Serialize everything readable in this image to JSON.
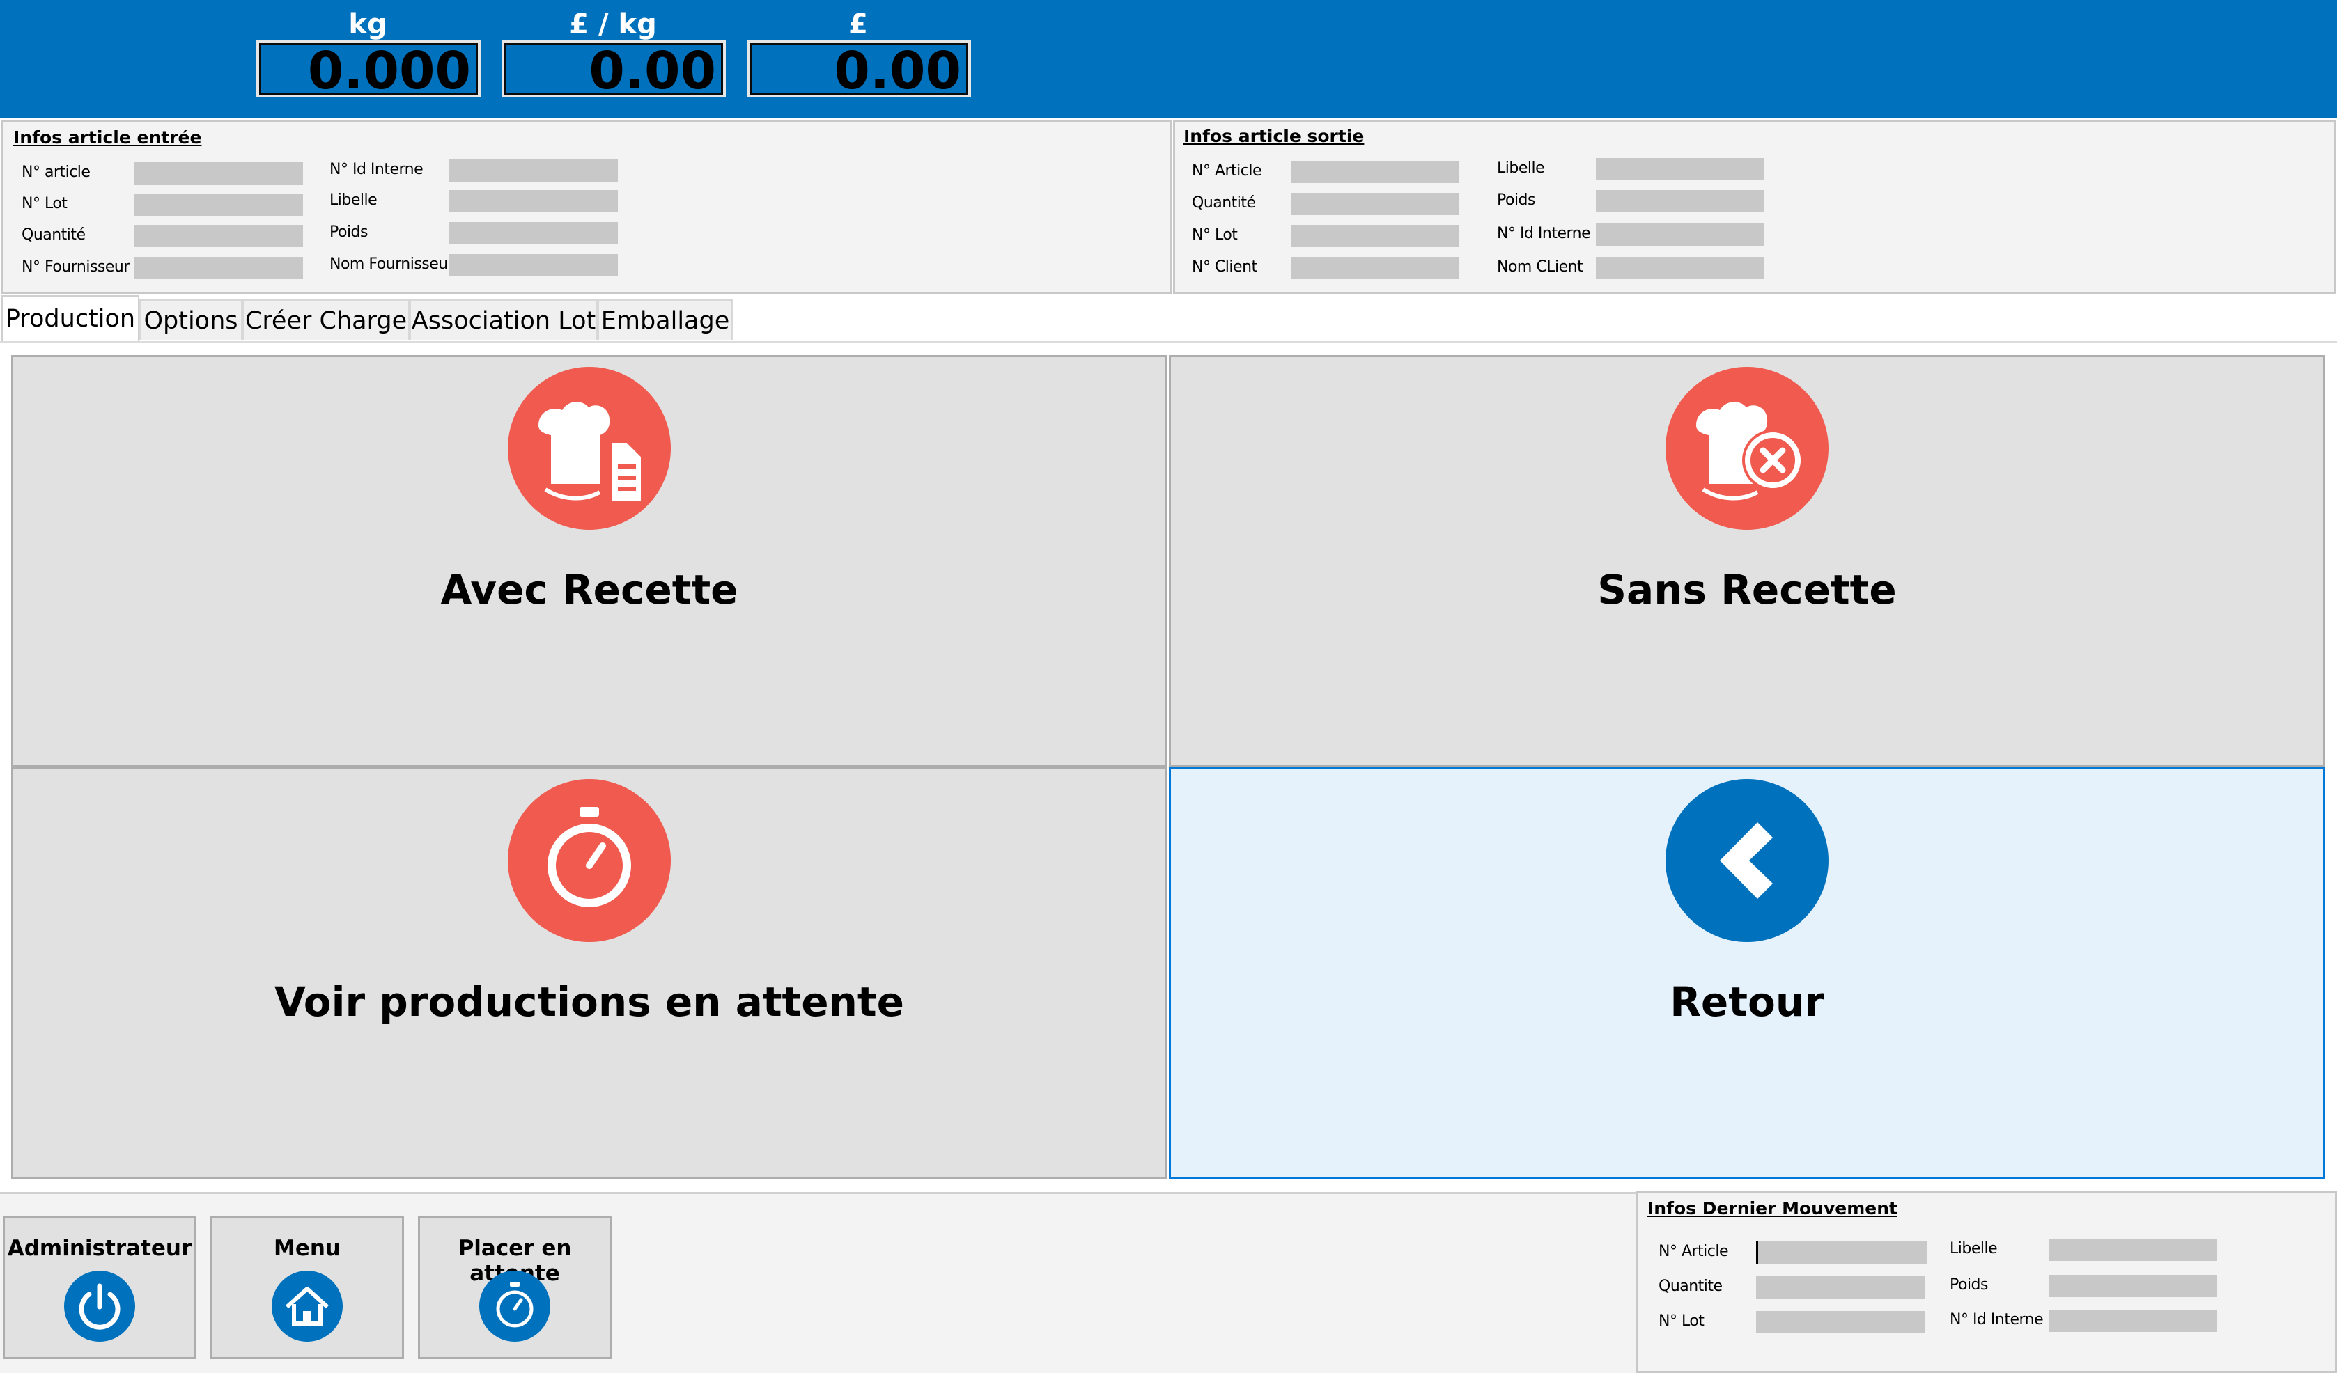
{
  "meters": [
    {
      "unit": "kg",
      "value": "0.000"
    },
    {
      "unit": "£ / kg",
      "value": "0.00"
    },
    {
      "unit": "£",
      "value": "0.00"
    }
  ],
  "input_panel": {
    "title": "Infos article entrée",
    "left_fields": [
      {
        "label": "N° article",
        "value": ""
      },
      {
        "label": "N° Lot",
        "value": ""
      },
      {
        "label": "Quantité",
        "value": ""
      },
      {
        "label": "N° Fournisseur",
        "value": ""
      }
    ],
    "right_fields": [
      {
        "label": "N° Id Interne",
        "value": ""
      },
      {
        "label": "Libelle",
        "value": ""
      },
      {
        "label": "Poids",
        "value": ""
      },
      {
        "label": "Nom Fournisseur",
        "value": ""
      }
    ]
  },
  "output_panel": {
    "title": "Infos article sortie",
    "left_fields": [
      {
        "label": "N° Article",
        "value": ""
      },
      {
        "label": "Quantité",
        "value": ""
      },
      {
        "label": "N° Lot",
        "value": ""
      },
      {
        "label": "N° Client",
        "value": ""
      }
    ],
    "right_fields": [
      {
        "label": "Libelle",
        "value": ""
      },
      {
        "label": "Poids",
        "value": ""
      },
      {
        "label": "N° Id Interne",
        "value": ""
      },
      {
        "label": "Nom CLient",
        "value": ""
      }
    ]
  },
  "tabs": [
    {
      "label": "Production",
      "active": true
    },
    {
      "label": "Options"
    },
    {
      "label": "Créer Charge"
    },
    {
      "label": "Association Lot"
    },
    {
      "label": "Emballage"
    }
  ],
  "tiles": [
    {
      "label": "Avec Recette",
      "icon": "chef-hat-recipe-icon"
    },
    {
      "label": "Sans Recette",
      "icon": "chef-hat-cancel-icon"
    },
    {
      "label": "Voir productions en attente",
      "icon": "stopwatch-icon"
    },
    {
      "label": "Retour",
      "icon": "chevron-left-icon"
    }
  ],
  "bottom_buttons": [
    {
      "label": "Administrateur",
      "icon": "power-icon"
    },
    {
      "label": "Menu",
      "icon": "home-icon"
    },
    {
      "label": "Placer en attente",
      "icon": "stopwatch-icon"
    }
  ],
  "last_move_panel": {
    "title": "Infos Dernier Mouvement",
    "left_fields": [
      {
        "label": "N° Article",
        "value": ""
      },
      {
        "label": "Quantite",
        "value": ""
      },
      {
        "label": "N° Lot",
        "value": ""
      }
    ],
    "right_fields": [
      {
        "label": "Libelle",
        "value": ""
      },
      {
        "label": "Poids",
        "value": ""
      },
      {
        "label": "N° Id Interne",
        "value": ""
      }
    ]
  },
  "colors": {
    "brand_blue": "#0071bc",
    "accent_red": "#f05a4f",
    "selected_tile_bg": "#e5f1fb"
  }
}
